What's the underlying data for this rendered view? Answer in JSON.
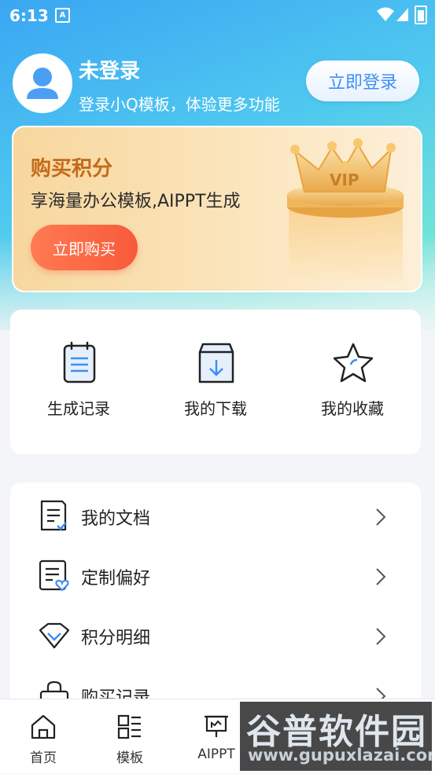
{
  "status_bar": {
    "time": "6:13",
    "sim_label": "A"
  },
  "header": {
    "title": "未登录",
    "subtitle": "登录小Q模板，体验更多功能",
    "login_button": "立即登录"
  },
  "buy_card": {
    "title": "购买积分",
    "subtitle": "享海量办公模板,AIPPT生成",
    "button": "立即购买",
    "badge_text": "VIP"
  },
  "quick_actions": [
    {
      "label": "生成记录",
      "icon": "clipboard-icon"
    },
    {
      "label": "我的下载",
      "icon": "download-box-icon"
    },
    {
      "label": "我的收藏",
      "icon": "star-icon"
    }
  ],
  "menu": [
    {
      "label": "我的文档",
      "icon": "document-check-icon"
    },
    {
      "label": "定制偏好",
      "icon": "document-heart-icon"
    },
    {
      "label": "积分明细",
      "icon": "diamond-icon"
    },
    {
      "label": "购买记录",
      "icon": "shopping-bag-icon"
    }
  ],
  "bottom_nav": [
    {
      "label": "首页",
      "icon": "home-icon"
    },
    {
      "label": "模板",
      "icon": "template-icon"
    },
    {
      "label": "AIPPT",
      "icon": "presentation-icon"
    }
  ],
  "watermark": {
    "text": "谷普软件园",
    "url": "www.gupuxlazai.com"
  },
  "colors": {
    "accent_blue": "#3e8ef5",
    "buy_title": "#c46a1c",
    "buy_button": "#f85a3a"
  }
}
